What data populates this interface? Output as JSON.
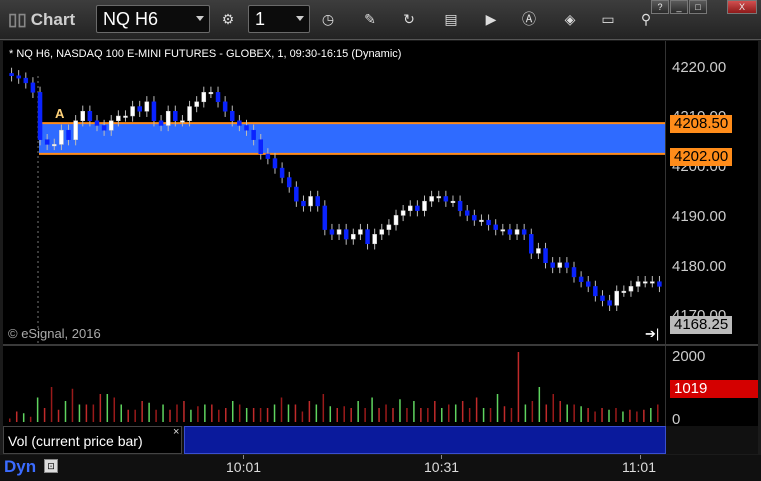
{
  "window": {
    "title": "Chart",
    "symbol": "NQ H6",
    "interval": "1",
    "controls": {
      "help": "?",
      "minimize": "_",
      "maximize": "□",
      "close": "X"
    }
  },
  "toolbar_icons": [
    "settings-gear-icon",
    "clock-icon",
    "pencil-icon",
    "refresh-icon",
    "table-icon",
    "play-icon",
    "alert-icon",
    "tag-icon",
    "monitor-icon",
    "pin-icon"
  ],
  "chart": {
    "header": "* NQ H6, NASDAQ 100 E-MINI FUTURES - GLOBEX, 1, 09:30-16:15 (Dynamic)",
    "copyright": "© eSignal, 2016",
    "annotation": "A",
    "price_axis_labels": [
      "4220.00",
      "4210.00",
      "4200.00",
      "4190.00",
      "4180.00",
      "4170.00"
    ],
    "zone_top_label": "4208.50",
    "zone_bottom_label": "4202.00",
    "last_price_label": "4168.25",
    "colors": {
      "zone_fill": "#2f6bff",
      "zone_border": "#ff8c1a",
      "up": "#ffffff",
      "down": "#0a23ff",
      "background": "#000000"
    }
  },
  "volume": {
    "axis_labels": [
      "2000",
      "0"
    ],
    "last_volume_label": "1019",
    "study_label": "Vol (current price bar)",
    "study_close": "×"
  },
  "time_axis": {
    "mode": "Dyn",
    "labels": [
      "10:01",
      "10:31",
      "11:01"
    ]
  },
  "chart_data": {
    "type": "candlestick",
    "price_range": [
      4165,
      4225
    ],
    "zone": {
      "top": 4208.5,
      "bottom": 4202.0
    },
    "last_price": 4168.25,
    "closes": [
      4218.5,
      4218,
      4217,
      4215,
      4205,
      4204,
      4204,
      4207,
      4205,
      4209,
      4211,
      4209,
      4208,
      4207,
      4209,
      4210,
      4210,
      4212,
      4211,
      4213,
      4209,
      4208,
      4211,
      4209,
      4209,
      4212,
      4213,
      4215,
      4215,
      4213,
      4211,
      4209,
      4208,
      4207,
      4205,
      4202,
      4201,
      4199,
      4197,
      4195,
      4192,
      4191,
      4193,
      4191,
      4186,
      4185,
      4186,
      4184,
      4185,
      4186,
      4183,
      4185,
      4186,
      4187,
      4189,
      4190,
      4191,
      4190,
      4192,
      4193,
      4193,
      4192,
      4192,
      4190,
      4189,
      4188,
      4188,
      4187,
      4186,
      4186,
      4185,
      4186,
      4185,
      4181,
      4182,
      4179,
      4178,
      4179,
      4178,
      4176,
      4175,
      4174,
      4172,
      4171,
      4170,
      4173,
      4173,
      4174,
      4175,
      4175,
      4175,
      4174
    ],
    "volume_range": [
      0,
      2000
    ],
    "volumes": [
      100,
      300,
      250,
      150,
      700,
      400,
      1000,
      350,
      600,
      950,
      500,
      500,
      500,
      800,
      800,
      700,
      500,
      350,
      350,
      600,
      550,
      350,
      500,
      350,
      500,
      600,
      350,
      450,
      500,
      500,
      350,
      400,
      600,
      500,
      400,
      400,
      400,
      400,
      500,
      700,
      500,
      500,
      300,
      600,
      500,
      800,
      450,
      400,
      450,
      400,
      600,
      400,
      700,
      400,
      500,
      400,
      650,
      400,
      600,
      400,
      400,
      600,
      400,
      500,
      500,
      600,
      400,
      700,
      400,
      400,
      800,
      450,
      400,
      2000,
      500,
      600,
      1000,
      500,
      800,
      600,
      500,
      500,
      450,
      400,
      300,
      400,
      350,
      400,
      300,
      350,
      300,
      350,
      400,
      500
    ],
    "time_labels": [
      "10:01",
      "10:31",
      "11:01"
    ]
  }
}
